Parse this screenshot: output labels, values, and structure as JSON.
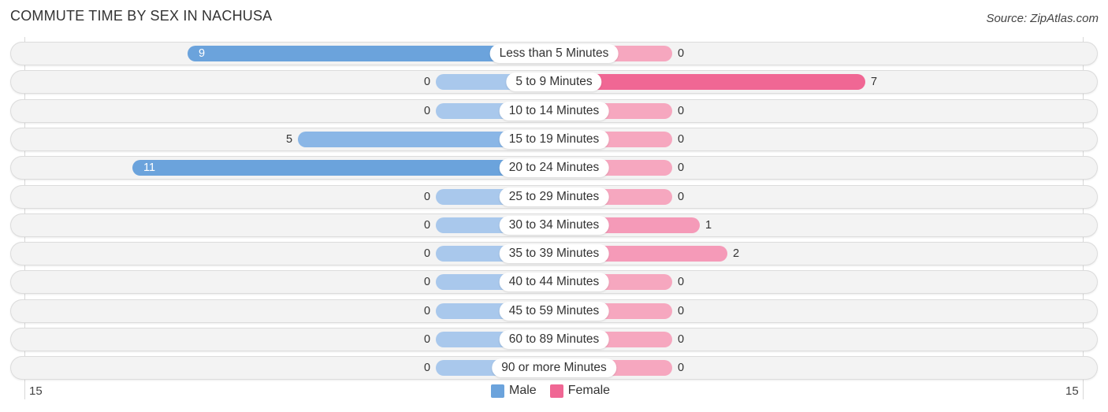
{
  "title": "COMMUTE TIME BY SEX IN NACHUSA",
  "source": "Source: ZipAtlas.com",
  "colors": {
    "male": "#6ba3dc",
    "male_light": "#a9c8ec",
    "female": "#f06794",
    "female_light": "#f6a7bf"
  },
  "chart_data": {
    "type": "bar",
    "orientation": "horizontal-diverging",
    "title": "COMMUTE TIME BY SEX IN NACHUSA",
    "categories": [
      "Less than 5 Minutes",
      "5 to 9 Minutes",
      "10 to 14 Minutes",
      "15 to 19 Minutes",
      "20 to 24 Minutes",
      "25 to 29 Minutes",
      "30 to 34 Minutes",
      "35 to 39 Minutes",
      "40 to 44 Minutes",
      "45 to 59 Minutes",
      "60 to 89 Minutes",
      "90 or more Minutes"
    ],
    "series": [
      {
        "name": "Male",
        "values": [
          9,
          0,
          0,
          5,
          11,
          0,
          0,
          0,
          0,
          0,
          0,
          0
        ]
      },
      {
        "name": "Female",
        "values": [
          0,
          7,
          0,
          0,
          0,
          0,
          1,
          2,
          0,
          0,
          0,
          0
        ]
      }
    ],
    "axis": {
      "left_tick": "15",
      "right_tick": "15",
      "range": [
        15,
        15
      ]
    },
    "legend": {
      "position": "bottom-center",
      "entries": [
        "Male",
        "Female"
      ]
    }
  }
}
